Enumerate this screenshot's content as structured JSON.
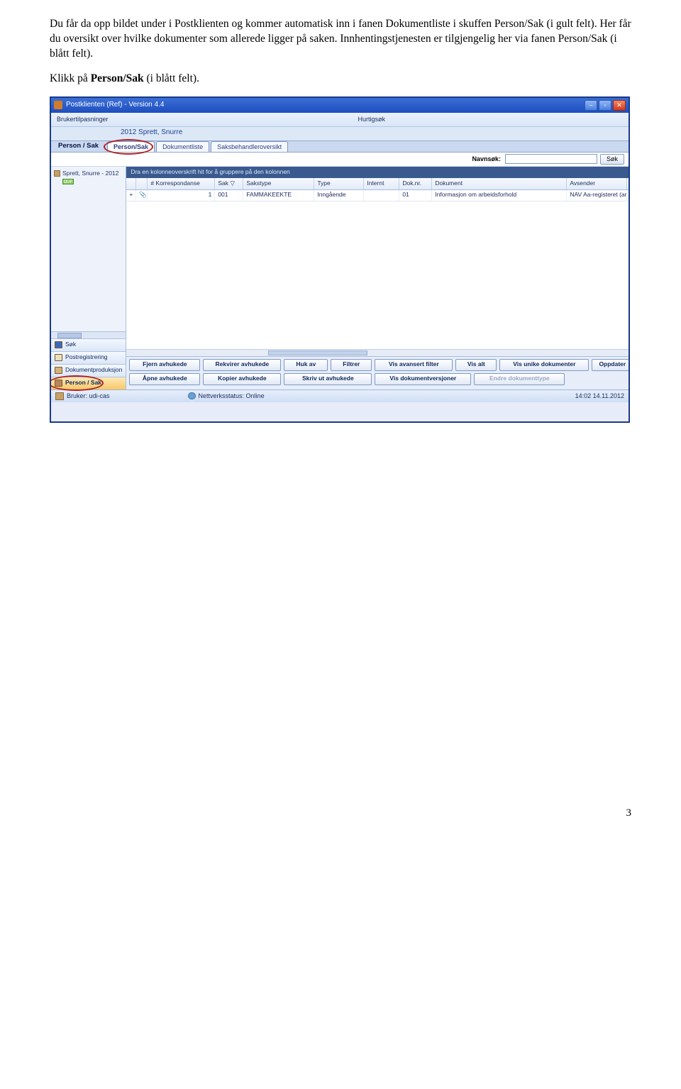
{
  "doc": {
    "para1_a": "Du får da opp bildet under i Postklienten og kommer automatisk inn i fanen Dokumentliste i skuffen Person/Sak (i gult felt). Her får du oversikt over hvilke dokumenter som allerede ligger på saken. Innhentingstjenesten er tilgjengelig her via fanen Person/Sak (i blått felt).",
    "para2_a": "Klikk på ",
    "para2_b": "Person/Sak",
    "para2_c": " (i blått felt).",
    "page_number": "3"
  },
  "app": {
    "title": "Postklienten (Ref) - Version 4.4",
    "toolbar_left": "Brukertilpasninger",
    "toolbar_hurtig": "Hurtigsøk",
    "year_name": "2012            Sprett, Snurre",
    "section": "Person / Sak",
    "tabs": {
      "t1": "Person/Sak",
      "t2": "Dokumentliste",
      "t3": "Saksbehandleroversikt"
    },
    "navnsok": "Navnsøk:",
    "sok": "Søk",
    "tree_root": "Sprett, Snurre - 2012",
    "tree_tag": "DUF",
    "group_hint": "Dra en kolonneoverskrift hit for å gruppere på den kolonnen",
    "cols": {
      "kor": "# Korrespondanse",
      "sak": "Sak  ▽",
      "saks": "Sakstype",
      "typ": "Type",
      "int": "Internt",
      "dok": "Dok.nr.",
      "dkm": "Dokument",
      "avs": "Avsender"
    },
    "row": {
      "kor": "1",
      "sak": "001",
      "saks": "FAMMAKEEKTE",
      "typ": "Inngående",
      "int": "",
      "dok": "01",
      "dkm": "Informasjon om arbeidsforhold",
      "avs": "NAV Aa-registeret (arbeidsgi"
    },
    "acc": {
      "sok": "Søk",
      "post": "Postregistrering",
      "doc": "Dokumentproduksjon",
      "person": "Person / Sak"
    },
    "btns": {
      "fjern": "Fjern avhukede",
      "rekv": "Rekvirer avhukede",
      "huk": "Huk av",
      "filt": "Filtrer",
      "visadv": "Vis avansert filter",
      "visalt": "Vis alt",
      "visun": "Vis unike dokumenter",
      "oppd": "Oppdater",
      "apne": "Åpne avhukede",
      "kopi": "Kopier avhukede",
      "skriv": "Skriv ut avhukede",
      "visver": "Vis dokumentversjoner",
      "endre": "Endre dokumenttype"
    },
    "status": {
      "user_lbl": "Bruker: udi-cas",
      "net": "Nettverksstatus: Online",
      "time": "14:02 14.11.2012"
    }
  }
}
